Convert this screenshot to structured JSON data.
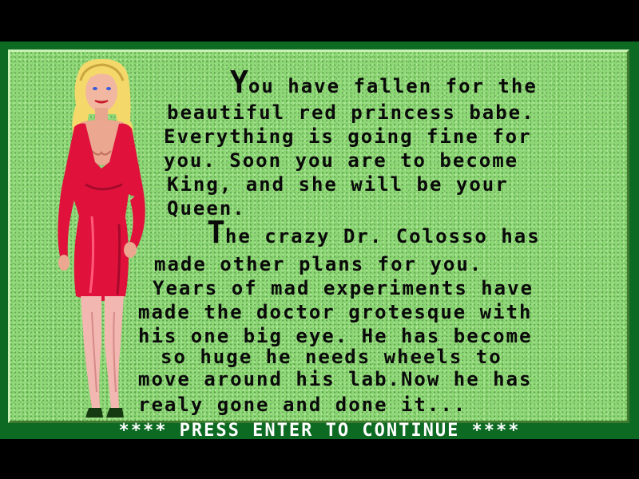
{
  "story": {
    "paragraph1": {
      "dropcap": "Y",
      "lines": [
        "ou have fallen for the",
        "beautiful red princess babe.",
        "Everything is going fine for",
        "you. Soon you are to become",
        "King, and she will be your",
        "Queen."
      ]
    },
    "paragraph2": {
      "dropcap": "T",
      "lines": [
        "he crazy Dr. Colosso has",
        "made other plans for you.",
        "Years of mad experiments have",
        "made the doctor grotesque with",
        "his one big eye. He has become",
        "so huge he needs wheels to",
        "move around his lab.Now he has",
        "realy gone and done it..."
      ]
    }
  },
  "footer": {
    "prompt": "**** PRESS ENTER TO CONTINUE ****"
  },
  "colors": {
    "panel_green": "#8ed776",
    "frame_green": "#0c6a22",
    "dress_red": "#e0123c",
    "hair_blonde": "#f4d86a"
  },
  "icons": {
    "portrait": "princess-portrait"
  }
}
